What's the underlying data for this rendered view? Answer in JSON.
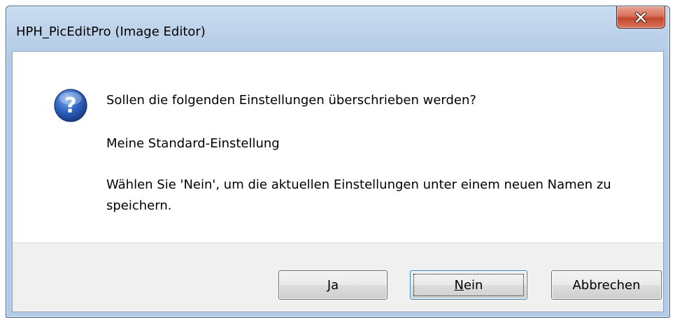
{
  "window": {
    "title": "HPH_PicEditPro (Image Editor)",
    "close_icon": "close-x-icon"
  },
  "dialog": {
    "icon": "question-icon",
    "message": "Sollen die folgenden Einstellungen überschrieben werden?",
    "setting_name": "Meine Standard-Einstellung",
    "hint": "Wählen Sie 'Nein', um die aktuellen Einstellungen unter einem neuen Namen zu speichern."
  },
  "buttons": {
    "yes": {
      "accel": "J",
      "rest": "a"
    },
    "no": {
      "accel": "N",
      "rest": "ein",
      "focused": true
    },
    "cancel": {
      "label": "Abbrechen"
    }
  },
  "colors": {
    "close_button": "#c4462c",
    "question_icon": "#2a5bb0",
    "footer_background": "#f0f0f0",
    "title_bar": "#bcd2ea"
  }
}
